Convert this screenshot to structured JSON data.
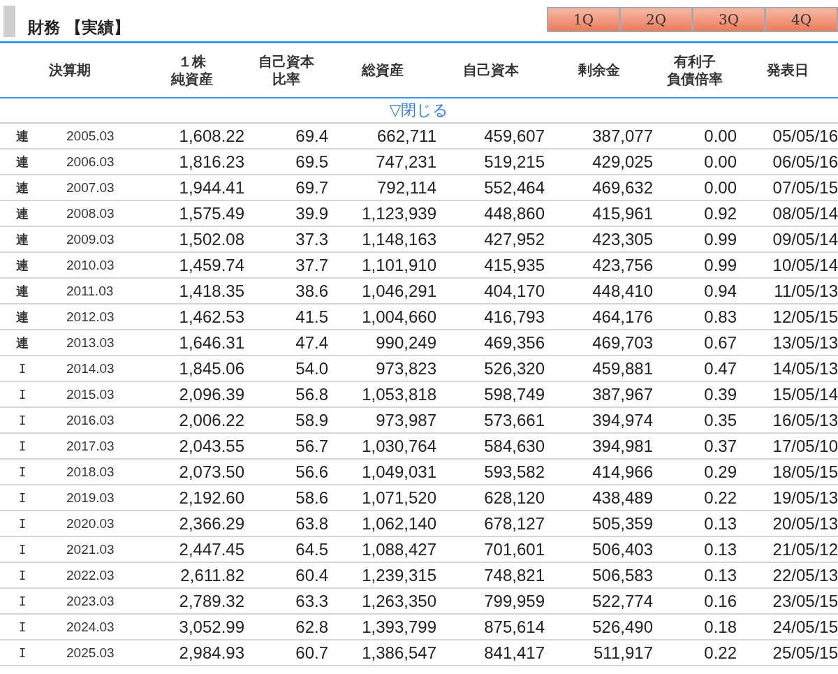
{
  "title": "財務 【実績】",
  "quarter_buttons": [
    "1Q",
    "2Q",
    "3Q",
    "4Q"
  ],
  "table": {
    "columns": [
      {
        "lines": [
          "決算期"
        ]
      },
      {
        "lines": [
          "１株",
          "純資産"
        ]
      },
      {
        "lines": [
          "自己資本",
          "比率"
        ]
      },
      {
        "lines": [
          "総資産"
        ]
      },
      {
        "lines": [
          "自己資本"
        ]
      },
      {
        "lines": [
          "剰余金"
        ]
      },
      {
        "lines": [
          "有利子",
          "負債倍率"
        ]
      },
      {
        "lines": [
          "発表日"
        ]
      }
    ],
    "collapse_link": "▽閉じる",
    "rows": [
      {
        "type": "連",
        "cells": [
          "2005.03",
          "1,608.22",
          "69.4",
          "662,711",
          "459,607",
          "387,077",
          "0.00",
          "05/05/16"
        ]
      },
      {
        "type": "連",
        "cells": [
          "2006.03",
          "1,816.23",
          "69.5",
          "747,231",
          "519,215",
          "429,025",
          "0.00",
          "06/05/16"
        ]
      },
      {
        "type": "連",
        "cells": [
          "2007.03",
          "1,944.41",
          "69.7",
          "792,114",
          "552,464",
          "469,632",
          "0.00",
          "07/05/15"
        ]
      },
      {
        "type": "連",
        "cells": [
          "2008.03",
          "1,575.49",
          "39.9",
          "1,123,939",
          "448,860",
          "415,961",
          "0.92",
          "08/05/14"
        ]
      },
      {
        "type": "連",
        "cells": [
          "2009.03",
          "1,502.08",
          "37.3",
          "1,148,163",
          "427,952",
          "423,305",
          "0.99",
          "09/05/14"
        ]
      },
      {
        "type": "連",
        "cells": [
          "2010.03",
          "1,459.74",
          "37.7",
          "1,101,910",
          "415,935",
          "423,756",
          "0.99",
          "10/05/14"
        ]
      },
      {
        "type": "連",
        "cells": [
          "2011.03",
          "1,418.35",
          "38.6",
          "1,046,291",
          "404,170",
          "448,410",
          "0.94",
          "11/05/13"
        ]
      },
      {
        "type": "連",
        "cells": [
          "2012.03",
          "1,462.53",
          "41.5",
          "1,004,660",
          "416,793",
          "464,176",
          "0.83",
          "12/05/15"
        ]
      },
      {
        "type": "連",
        "cells": [
          "2013.03",
          "1,646.31",
          "47.4",
          "990,249",
          "469,356",
          "469,703",
          "0.67",
          "13/05/13"
        ]
      },
      {
        "type": "I",
        "cells": [
          "2014.03",
          "1,845.06",
          "54.0",
          "973,823",
          "526,320",
          "459,881",
          "0.47",
          "14/05/13"
        ]
      },
      {
        "type": "I",
        "cells": [
          "2015.03",
          "2,096.39",
          "56.8",
          "1,053,818",
          "598,749",
          "387,967",
          "0.39",
          "15/05/14"
        ]
      },
      {
        "type": "I",
        "cells": [
          "2016.03",
          "2,006.22",
          "58.9",
          "973,987",
          "573,661",
          "394,974",
          "0.35",
          "16/05/13"
        ]
      },
      {
        "type": "I",
        "cells": [
          "2017.03",
          "2,043.55",
          "56.7",
          "1,030,764",
          "584,630",
          "394,981",
          "0.37",
          "17/05/10"
        ]
      },
      {
        "type": "I",
        "cells": [
          "2018.03",
          "2,073.50",
          "56.6",
          "1,049,031",
          "593,582",
          "414,966",
          "0.29",
          "18/05/15"
        ]
      },
      {
        "type": "I",
        "cells": [
          "2019.03",
          "2,192.60",
          "58.6",
          "1,071,520",
          "628,120",
          "438,489",
          "0.22",
          "19/05/13"
        ]
      },
      {
        "type": "I",
        "cells": [
          "2020.03",
          "2,366.29",
          "63.8",
          "1,062,140",
          "678,127",
          "505,359",
          "0.13",
          "20/05/13"
        ]
      },
      {
        "type": "I",
        "cells": [
          "2021.03",
          "2,447.45",
          "64.5",
          "1,088,427",
          "701,601",
          "506,403",
          "0.13",
          "21/05/12"
        ]
      },
      {
        "type": "I",
        "cells": [
          "2022.03",
          "2,611.82",
          "60.4",
          "1,239,315",
          "748,821",
          "506,583",
          "0.13",
          "22/05/13"
        ]
      },
      {
        "type": "I",
        "cells": [
          "2023.03",
          "2,789.32",
          "63.3",
          "1,263,350",
          "799,959",
          "522,774",
          "0.16",
          "23/05/15"
        ]
      },
      {
        "type": "I",
        "cells": [
          "2024.03",
          "3,052.99",
          "62.8",
          "1,393,799",
          "875,614",
          "526,490",
          "0.18",
          "24/05/15"
        ]
      },
      {
        "type": "I",
        "cells": [
          "2025.03",
          "2,984.93",
          "60.7",
          "1,386,547",
          "841,417",
          "511,917",
          "0.22",
          "25/05/15"
        ]
      }
    ]
  }
}
